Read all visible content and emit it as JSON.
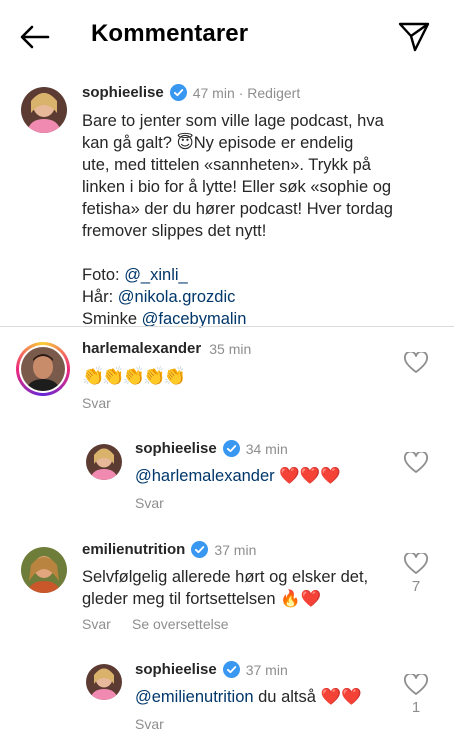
{
  "header": {
    "title": "Kommentarer",
    "back_icon": "arrow-left-icon",
    "share_icon": "paper-plane-icon"
  },
  "caption": {
    "username": "sophieelise",
    "time": "47 min",
    "edited": "· Redigert",
    "line1": "Bare to jenter som ville lage podcast, hva",
    "line2": "kan gå galt? 😇Ny episode er endelig",
    "line3": "ute, med tittelen «sannheten». Trykk på",
    "line4": "linken i bio for å lytte! Eller søk «sophie og",
    "line5": "fetisha» der du hører podcast! Hver tordag",
    "line6": "fremover slippes det nytt!",
    "photo_label": "Foto: ",
    "photo_handle": "@_xinli_",
    "hair_label": "Hår: ",
    "hair_handle": "@nikola.grozdic",
    "makeup_label": "Sminke ",
    "makeup_handle": "@facebymalin"
  },
  "comments": [
    {
      "username": "harlemalexander",
      "time": "35 min",
      "text": "👏👏👏👏👏",
      "reply_label": "Svar"
    },
    {
      "username": "sophieelise",
      "time": "34 min",
      "mention": "@harlemalexander",
      "text": "❤️❤️❤️",
      "reply_label": "Svar"
    },
    {
      "username": "emilienutrition",
      "time": "37 min",
      "line1": "Selvfølgelig allerede hørt og elsker det,",
      "line2": "gleder meg til fortsettelsen 🔥❤️",
      "reply_label": "Svar",
      "translate_label": "Se oversettelse",
      "likes": "7"
    },
    {
      "username": "sophieelise",
      "time": "37 min",
      "mention": "@emilienutrition",
      "text": " du altså ❤️❤️",
      "reply_label": "Svar",
      "likes": "1"
    }
  ],
  "colors": {
    "verified": "#3897f0",
    "mention": "#00376b",
    "muted": "#8e8e8e"
  }
}
